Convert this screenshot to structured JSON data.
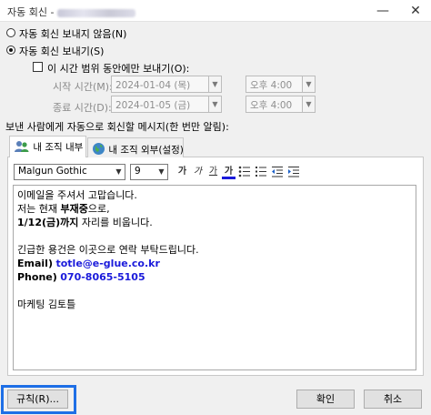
{
  "window": {
    "title": "자동 회신 -",
    "minimize_glyph": "—",
    "close_glyph": "✕"
  },
  "options": {
    "no_reply_label": "자동 회신 보내지 않음(N)",
    "send_reply_label": "자동 회신 보내기(S)",
    "time_range_label": "이 시간 범위 동안에만 보내기(O):",
    "start_time_label": "시작 시간(M):",
    "end_time_label": "종료 시간(D):",
    "start_date": "2024-01-04 (목)",
    "start_time": "오후 4:00",
    "end_date": "2024-01-05 (금)",
    "end_time": "오후 4:00"
  },
  "message_section_label": "보낸 사람에게 자동으로 회신할 메시지(한 번만 알림):",
  "tabs": [
    {
      "label": "내 조직 내부"
    },
    {
      "label": "내 조직 외부(설정)"
    }
  ],
  "toolbar": {
    "font_name": "Malgun Gothic",
    "font_size": "9",
    "bold_glyph": "가",
    "italic_glyph": "가",
    "underline_glyph": "가",
    "color_glyph": "가"
  },
  "message": {
    "line1": "이메일을 주셔서 고맙습니다.",
    "line2_prefix": "저는 현재 ",
    "line2_bold": "부재중",
    "line2_suffix": "으로,",
    "line3_bold": "1/12(금)까지",
    "line3_suffix": " 자리를 비웁니다.",
    "line4": "긴급한 용건은 이곳으로 연락 부탁드립니다.",
    "email_label": "Email)",
    "email_value": "totle@e-glue.co.kr",
    "phone_label": "Phone)",
    "phone_value": "070-8065-5105",
    "signature": "마케팅 김토틀"
  },
  "buttons": {
    "rules": "규칙(R)...",
    "ok": "확인",
    "cancel": "취소"
  },
  "colors": {
    "highlight": "#1e6fe6",
    "link_blue": "#1a1adb"
  }
}
